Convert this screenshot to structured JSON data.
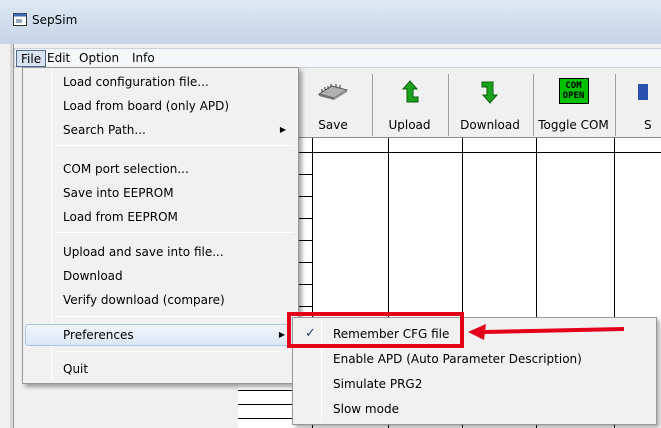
{
  "window": {
    "title": "SepSim"
  },
  "menubar": {
    "items": [
      "File",
      "Edit",
      "Option",
      "Info"
    ]
  },
  "toolbar": {
    "buttons": [
      {
        "label": "Save",
        "icon": "chip-icon"
      },
      {
        "label": "Upload",
        "icon": "upload-arrow-icon"
      },
      {
        "label": "Download",
        "icon": "download-arrow-icon"
      },
      {
        "label": "Toggle COM",
        "icon": "com-open-icon",
        "icon_text": "COM OPEN"
      },
      {
        "label": "S",
        "icon": "partial-icon"
      }
    ]
  },
  "file_menu": {
    "items": [
      "Load configuration file...",
      "Load from board (only APD)",
      "Search Path...",
      "COM port selection...",
      "Save into EEPROM",
      "Load from EEPROM",
      "Upload and save into file...",
      "Download",
      "Verify download (compare)",
      "Preferences",
      "Quit"
    ]
  },
  "preferences_submenu": {
    "items": [
      {
        "label": "Remember CFG file",
        "checked": true
      },
      {
        "label": "Enable APD (Auto Parameter Description)",
        "checked": false
      },
      {
        "label": "Simulate PRG2",
        "checked": false
      },
      {
        "label": "Slow mode",
        "checked": false
      }
    ]
  },
  "colors": {
    "annotation_red": "#e3001b",
    "com_green": "#00c000",
    "arrow_green": "#1aa31a"
  }
}
